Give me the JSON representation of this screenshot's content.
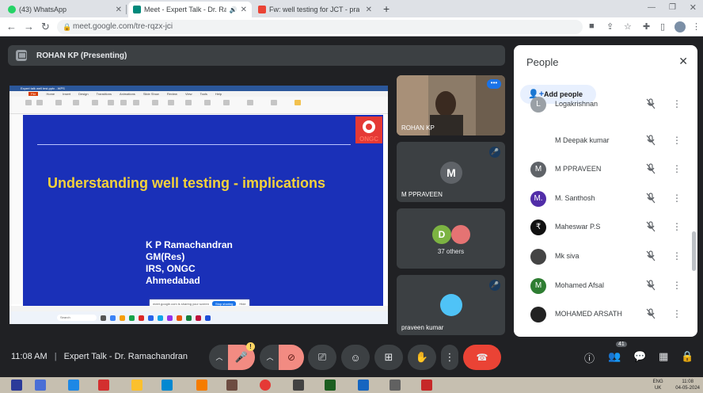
{
  "browser": {
    "tabs": [
      {
        "title": "(43) WhatsApp",
        "favicon_color": "#25d366",
        "active": false
      },
      {
        "title": "Meet - Expert Talk - Dr. Ram",
        "favicon_color": "#00897b",
        "active": true
      },
      {
        "title": "Fw: well testing for JCT - praveen",
        "favicon_color": "#ea4335",
        "active": false
      }
    ],
    "new_tab_icon": "+",
    "url": "meet.google.com/tre-rqzx-jci"
  },
  "presenting": {
    "label": "ROHAN KP (Presenting)"
  },
  "slide": {
    "app_title": "Expert talk well test.pptx - WPS",
    "menu": [
      "File",
      "Home",
      "Insert",
      "Design",
      "Transitions",
      "Animations",
      "Slide Show",
      "Review",
      "View",
      "Tools",
      "Help"
    ],
    "logo_text": "ONGC",
    "heading": "Understanding well testing - implications",
    "author_lines": [
      "K P Ramachandran",
      "GM(Res)",
      "IRS, ONGC",
      "Ahmedabad"
    ],
    "popup_text": "meet.google.com is sharing your screen",
    "popup_button": "Stop sharing",
    "popup_hide": "Hide",
    "taskbar_search": "Search"
  },
  "tiles": [
    {
      "name": "ROHAN KP"
    },
    {
      "name": "M PPRAVEEN",
      "initial": "M"
    },
    {
      "name": "37 others",
      "initial": "D"
    },
    {
      "name": "praveen kumar"
    }
  ],
  "people": {
    "title": "People",
    "add_label": "Add people",
    "list": [
      {
        "name": "Logakrishnan",
        "initial": "L",
        "color": "#9aa0a6"
      },
      {
        "name": "M Deepak kumar",
        "initial": "",
        "color": "#ffffff"
      },
      {
        "name": "M PPRAVEEN",
        "initial": "M",
        "color": "#5f6368"
      },
      {
        "name": "M. Santhosh",
        "initial": "M.",
        "color": "#512da8"
      },
      {
        "name": "Maheswar P.S",
        "initial": "₹",
        "color": "#111111"
      },
      {
        "name": "Mk siva",
        "initial": "",
        "color": "#444444"
      },
      {
        "name": "Mohamed Afsal",
        "initial": "M",
        "color": "#2e7d32"
      },
      {
        "name": "MOHAMED ARSATH",
        "initial": "",
        "color": "#222222"
      }
    ]
  },
  "bottom": {
    "time": "11:08 AM",
    "separator": "|",
    "meeting_title": "Expert Talk - Dr. Ramachandran",
    "participant_count": "41",
    "warning": "!"
  },
  "os": {
    "tray_lang": "ENG",
    "tray_region": "UK",
    "tray_time": "11:08",
    "tray_date": "04-05-2024"
  },
  "colors": {
    "meet_bg": "#202124",
    "slide_bg": "#1a30b8",
    "slide_heading": "#f4d23a",
    "end_call": "#ea4335"
  }
}
